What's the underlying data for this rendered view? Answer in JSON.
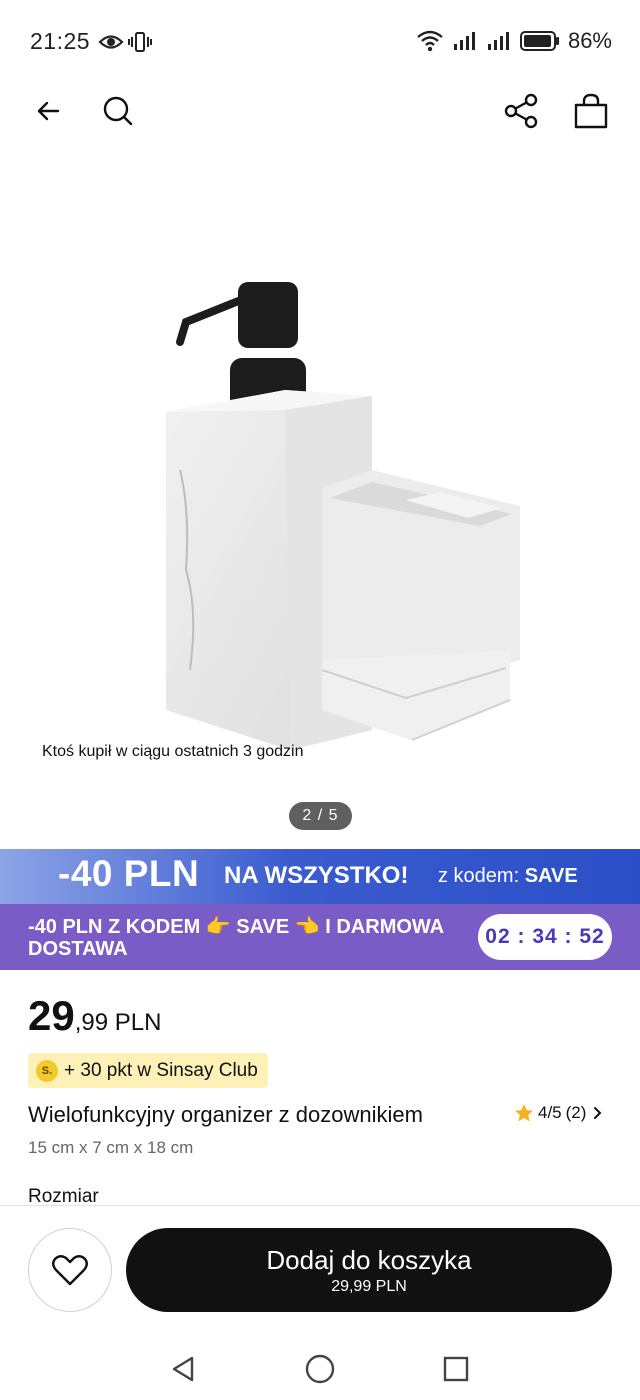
{
  "status_bar": {
    "time": "21:25",
    "battery": "86%",
    "icons": [
      "eye-icon",
      "vibrate-icon",
      "wifi-icon",
      "signal-icon",
      "signal-icon",
      "battery-icon"
    ]
  },
  "nav": {
    "icons": [
      "back-arrow-icon",
      "search-icon",
      "share-icon",
      "shopping-bag-icon"
    ]
  },
  "gallery": {
    "social_proof": "Ktoś kupił w ciągu ostatnich 3 godzin",
    "page_indicator": "2 / 5"
  },
  "promo": {
    "amount": "-40 PLN",
    "headline": "NA WSZYSTKO!",
    "code_prefix": "z kodem:",
    "code": "SAVE"
  },
  "countdown": {
    "text": "-40 PLN Z KODEM 👉 SAVE 👈 I DARMOWA DOSTAWA",
    "timer": "02 : 34 : 52"
  },
  "product": {
    "price_int": "29",
    "price_dec": ",99 PLN",
    "club_coin": "S.",
    "club_points": "+ 30 pkt w Sinsay Club",
    "title": "Wielofunkcyjny organizer z dozownikiem",
    "rating": "4/5",
    "rating_count": "(2)",
    "dimensions": "15 cm x 7 cm x 18 cm",
    "size_label": "Rozmiar"
  },
  "cta": {
    "add_to_cart": "Dodaj do koszyka",
    "price": "29,99 PLN"
  },
  "colors": {
    "promo_blue": "#2b4fc7",
    "countdown_purple": "#7a5cc6",
    "timer_text": "#4a3bb5",
    "club_badge": "#fdf1b7",
    "cta_bg": "#111111",
    "star": "#f2b51d"
  }
}
